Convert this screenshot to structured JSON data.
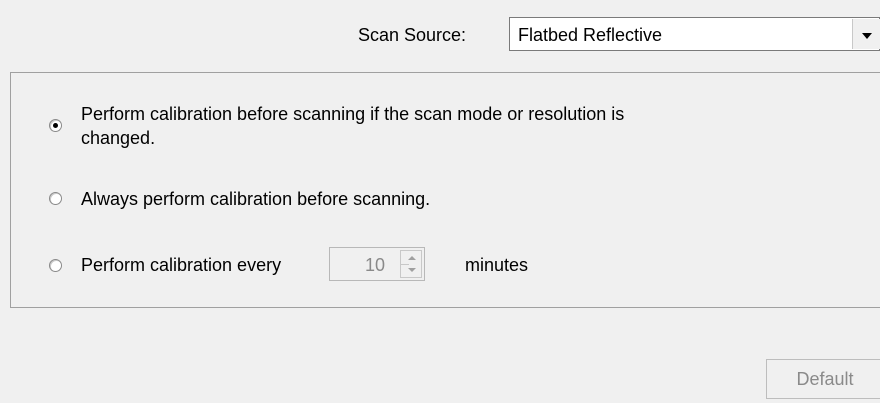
{
  "scan_source": {
    "label": "Scan Source:",
    "selected": "Flatbed Reflective",
    "arrow_icon": "▼"
  },
  "calibration": {
    "option1_line1": "Perform calibration before scanning if the scan mode or resolution is",
    "option1_line2": "changed.",
    "option1_checked": true,
    "option2": "Always perform calibration before scanning.",
    "option2_checked": false,
    "option3": "Perform calibration every",
    "option3_checked": false,
    "interval_value": "10",
    "interval_unit": "minutes"
  },
  "buttons": {
    "default_label": "Default"
  },
  "colors": {
    "background": "#f0f0f0",
    "disabled_text": "#8a8a8a"
  }
}
